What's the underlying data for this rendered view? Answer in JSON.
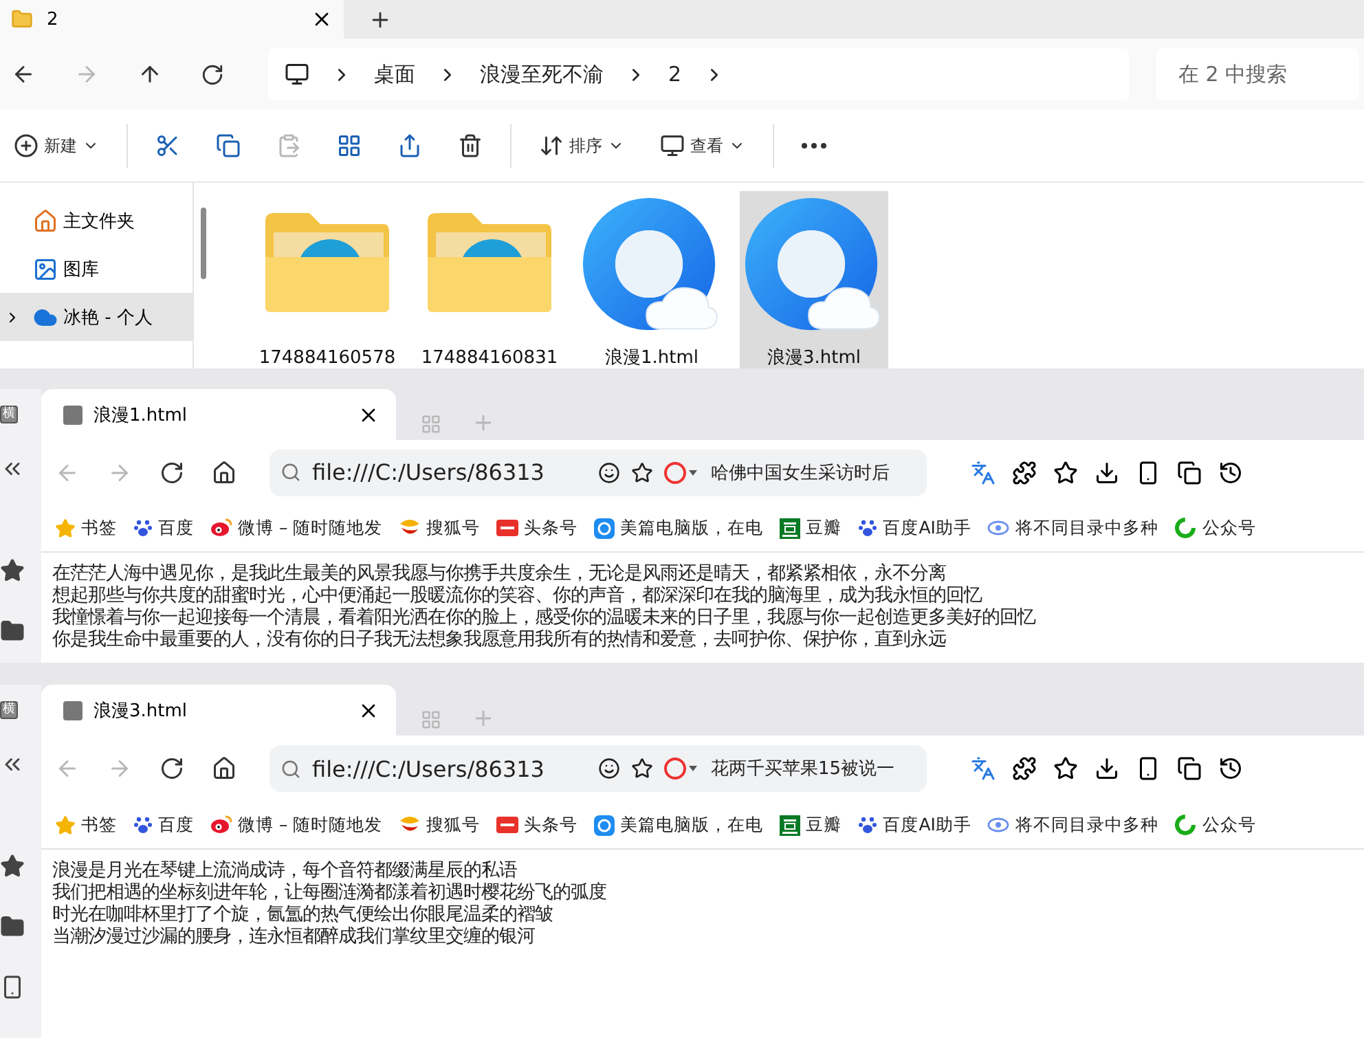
{
  "explorer": {
    "tab": {
      "title": "2"
    },
    "breadcrumb": [
      "桌面",
      "浪漫至死不渝",
      "2"
    ],
    "search": {
      "placeholder": "在 2 中搜索"
    },
    "commands": [
      {
        "kind": "new",
        "label": "新建",
        "disabled": false
      },
      {
        "kind": "cut",
        "disabled": false
      },
      {
        "kind": "copy",
        "disabled": false
      },
      {
        "kind": "paste",
        "disabled": true
      },
      {
        "kind": "rename",
        "disabled": false
      },
      {
        "kind": "share",
        "disabled": false
      },
      {
        "kind": "delete",
        "disabled": false
      },
      {
        "kind": "sort",
        "label": "排序",
        "disabled": false
      },
      {
        "kind": "view",
        "label": "查看",
        "disabled": false
      },
      {
        "kind": "more",
        "disabled": false
      }
    ],
    "sidebar": [
      {
        "kind": "home",
        "label": "主文件夹",
        "selected": false
      },
      {
        "kind": "gallery",
        "label": "图库",
        "selected": false
      },
      {
        "kind": "cloud",
        "label": "冰艳 - 个人",
        "selected": true
      }
    ],
    "files": [
      {
        "kind": "folder",
        "name": "174884160578",
        "selected": false
      },
      {
        "kind": "folder",
        "name": "174884160831",
        "selected": false
      },
      {
        "kind": "html",
        "name": "浪漫1.html",
        "selected": false
      },
      {
        "kind": "html",
        "name": "浪漫3.html",
        "selected": true
      }
    ]
  },
  "browsers": [
    {
      "side_badge": "横",
      "tab_title": "浪漫1.html",
      "address": "file:///C:/Users/86313",
      "search_text": "哈佛中国女生采访时后",
      "bookmarks": [
        {
          "kind": "star",
          "label": "书签"
        },
        {
          "kind": "paw",
          "label": "百度"
        },
        {
          "kind": "weibo",
          "label": "微博 – 随时随地发"
        },
        {
          "kind": "sohu",
          "label": "搜狐号"
        },
        {
          "kind": "toutiao",
          "label": "头条号"
        },
        {
          "kind": "meipian",
          "label": "美篇电脑版，在电"
        },
        {
          "kind": "douban",
          "label": "豆瓣"
        },
        {
          "kind": "paw",
          "label": "百度AI助手"
        },
        {
          "kind": "eye",
          "label": "将不同目录中多种"
        },
        {
          "kind": "wechat",
          "label": "公众号"
        }
      ],
      "lines": [
        "在茫茫人海中遇见你，是我此生最美的风景我愿与你携手共度余生，无论是风雨还是晴天，都紧紧相依，永不分离",
        "想起那些与你共度的甜蜜时光，心中便涌起一股暖流你的笑容、你的声音，都深深印在我的脑海里，成为我永恒的回忆",
        "我憧憬着与你一起迎接每一个清晨，看着阳光洒在你的脸上，感受你的温暖未来的日子里，我愿与你一起创造更多美好的回忆",
        "你是我生命中最重要的人，没有你的日子我无法想象我愿意用我所有的热情和爱意，去呵护你、保护你，直到永远"
      ]
    },
    {
      "side_badge": "横",
      "tab_title": "浪漫3.html",
      "address": "file:///C:/Users/86313",
      "search_text": "花两千买苹果15被说一",
      "bookmarks": [
        {
          "kind": "star",
          "label": "书签"
        },
        {
          "kind": "paw",
          "label": "百度"
        },
        {
          "kind": "weibo",
          "label": "微博 – 随时随地发"
        },
        {
          "kind": "sohu",
          "label": "搜狐号"
        },
        {
          "kind": "toutiao",
          "label": "头条号"
        },
        {
          "kind": "meipian",
          "label": "美篇电脑版，在电"
        },
        {
          "kind": "douban",
          "label": "豆瓣"
        },
        {
          "kind": "paw",
          "label": "百度AI助手"
        },
        {
          "kind": "eye",
          "label": "将不同目录中多种"
        },
        {
          "kind": "wechat",
          "label": "公众号"
        }
      ],
      "lines": [
        "浪漫是月光在琴键上流淌成诗，每个音符都缀满星辰的私语",
        "我们把相遇的坐标刻进年轮，让每圈涟漪都漾着初遇时樱花纷飞的弧度",
        "时光在咖啡杯里打了个旋，氤氲的热气便绘出你眼尾温柔的褶皱",
        "当潮汐漫过沙漏的腰身，连永恒都醉成我们掌纹里交缠的银河"
      ]
    }
  ]
}
